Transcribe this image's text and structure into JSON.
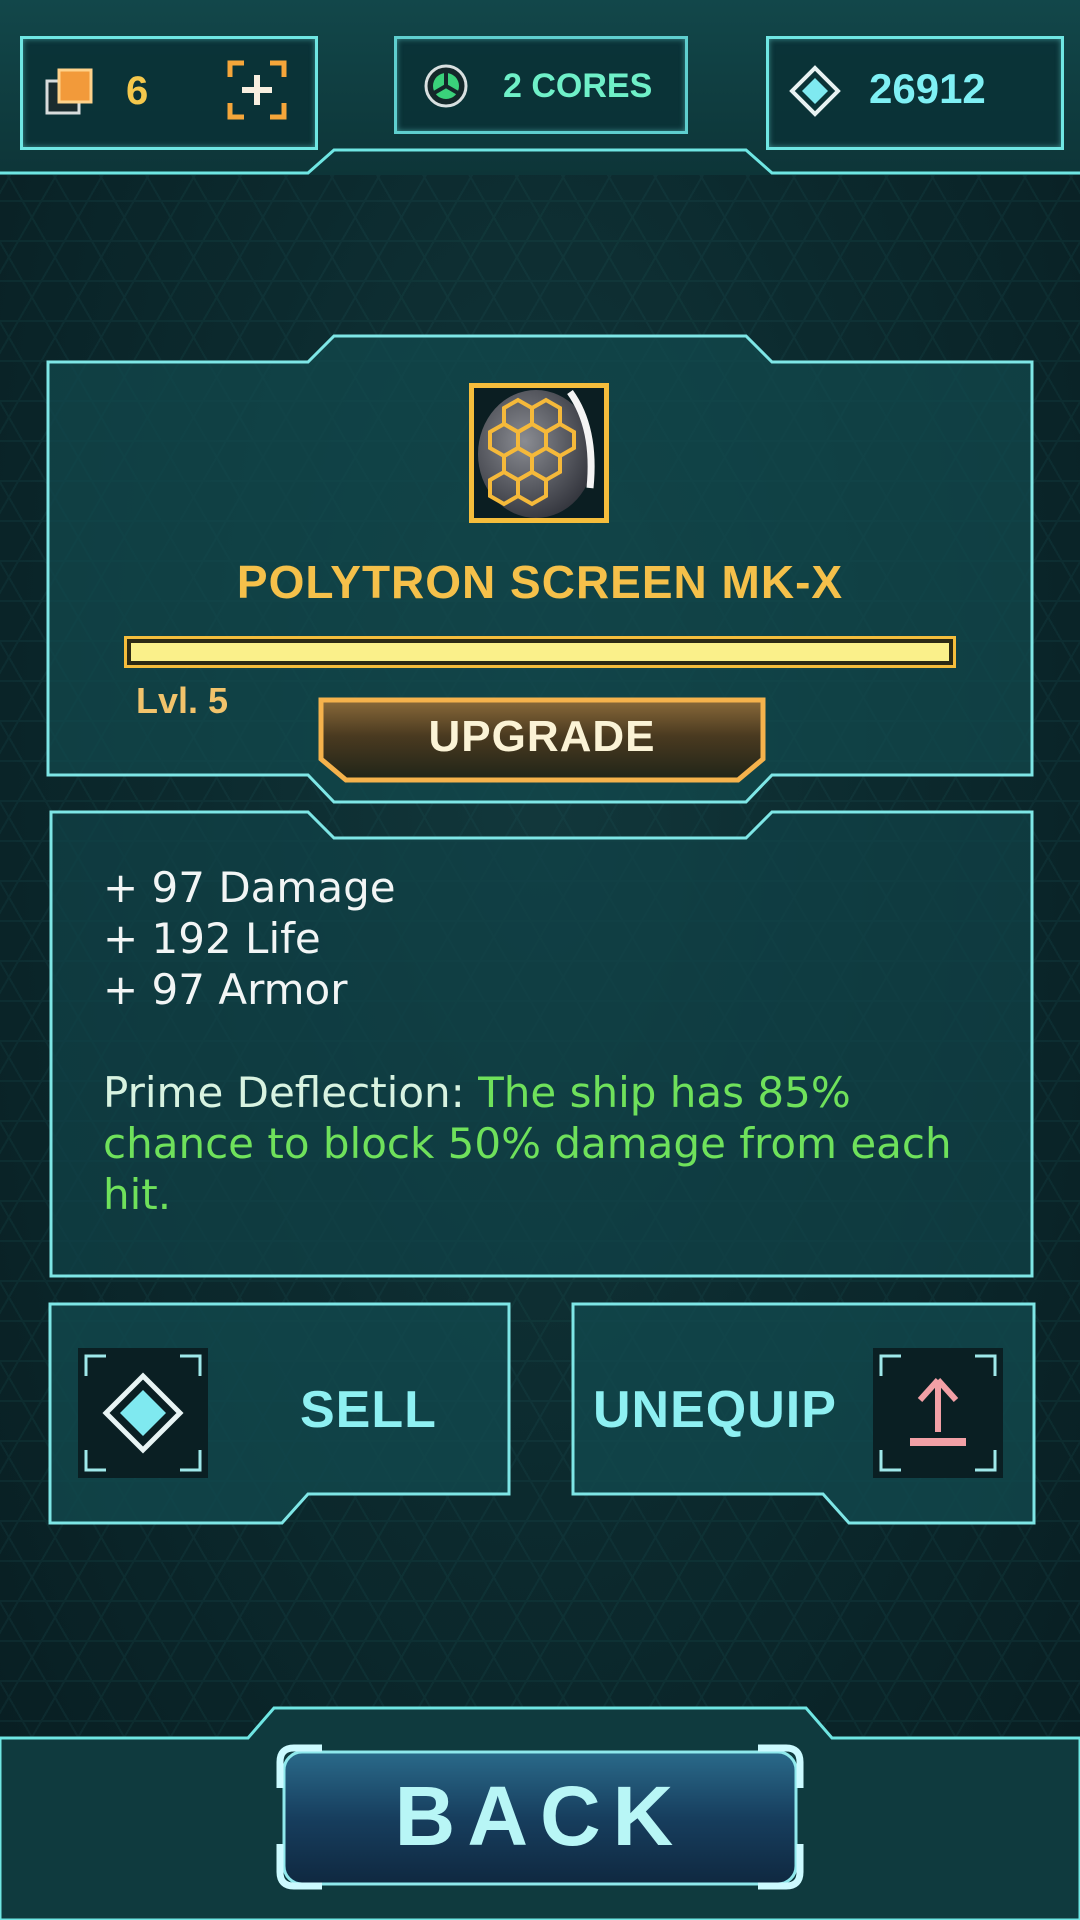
{
  "header": {
    "cards_count": "6",
    "cores_label": "2 CORES",
    "gems_count": "26912"
  },
  "item": {
    "name": "POLYTRON SCREEN MK-X",
    "level_label": "Lvl. 5",
    "xp_progress": 1.0,
    "upgrade_label": "UPGRADE"
  },
  "stats": {
    "lines": [
      "+ 97 Damage",
      "+ 192 Life",
      "+ 97 Armor"
    ],
    "ability_name": "Prime Deflection: ",
    "ability_desc": "The ship has 85% chance to block 50% damage from each hit."
  },
  "actions": {
    "sell_label": "SELL",
    "unequip_label": "UNEQUIP"
  },
  "footer": {
    "back_label": "BACK"
  },
  "colors": {
    "accent_cyan": "#6fe6e3",
    "gold": "#f5bd3c",
    "ability_green": "#6fe15b"
  }
}
